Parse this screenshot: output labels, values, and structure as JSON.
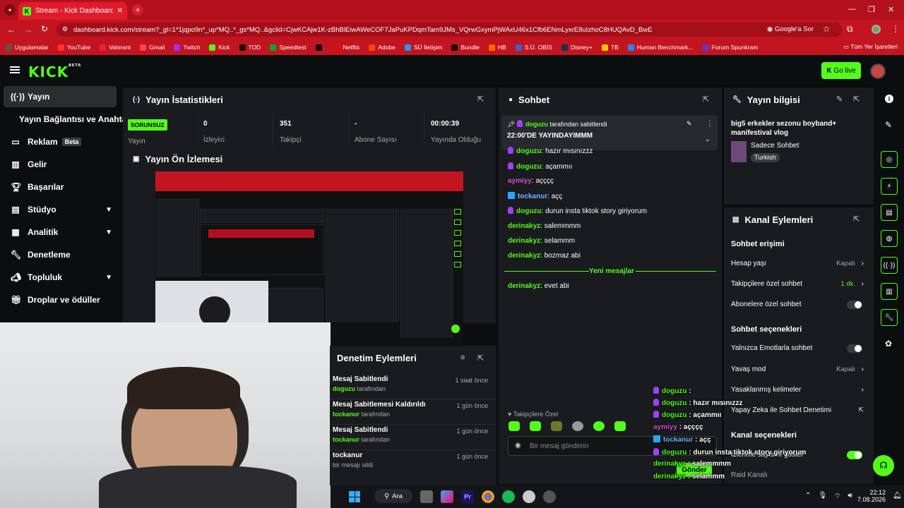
{
  "browser": {
    "tab_title": "Stream - Kick Dashboard",
    "url": "dashboard.kick.com/stream?_gl=1*1jqpo9n*_up*MQ..*_gs*MQ..&gclid=CjwKCAjw1K-zBhBlEiwAWeCOF7JaPuKPDqmTam9JMs_VQrwGxymPjWAxU46x1Cfb6ENmLyxrE8uIzhoC8HUQAvD_BwE",
    "ask_google": "Google'a Sor",
    "bookmarks": [
      "Uygulamalar",
      "YouTube",
      "Valorant",
      "Gmail",
      "Twitch",
      "Kick",
      "TOD",
      "Speedtest",
      "",
      "Netflix",
      "Adobe",
      "SÜ İletişim",
      "Bundle",
      "HB",
      "S.Ü. OBİS",
      "Disney+",
      "TB",
      "Human Benchmark...",
      "Forum Spunkram"
    ],
    "all_bookmarks": "Tüm Yer İşaretleri"
  },
  "header": {
    "logo": "KICK",
    "logo_sup": "BETA",
    "go_live": "Go live"
  },
  "sidebar": {
    "items": [
      {
        "label": "Yayın",
        "icon": "broadcast-icon"
      },
      {
        "label": "Yayın Bağlantısı ve Anahtarı"
      },
      {
        "label": "Reklam",
        "badge": "Beta",
        "icon": "tv-icon"
      },
      {
        "label": "Gelir",
        "icon": "chart-icon"
      },
      {
        "label": "Başarılar",
        "icon": "trophy-icon"
      },
      {
        "label": "Stüdyo",
        "icon": "studio-icon"
      },
      {
        "label": "Analitik",
        "icon": "analytics-icon"
      },
      {
        "label": "Denetleme",
        "icon": "wrench-icon"
      },
      {
        "label": "Topluluk",
        "icon": "megaphone-icon"
      },
      {
        "label": "Droplar ve ödüller",
        "icon": "gift-icon"
      }
    ]
  },
  "stats": {
    "title": "Yayın İstatistikleri",
    "status": "SORUNSUZ",
    "status_label": "Yayın",
    "viewers": "0",
    "viewers_label": "İzleyici",
    "followers": "351",
    "followers_label": "Takipçi",
    "subs": "-",
    "subs_label": "Abone Sayısı",
    "uptime": "00:00:39",
    "uptime_label": "Yayında Olduğu"
  },
  "preview": {
    "title": "Yayın Ön İzlemesi"
  },
  "moderation": {
    "title": "Denetim Eylemleri",
    "rows": [
      {
        "action": "Mesaj Sabitlendi",
        "user": "doguzu",
        "suffix": "tarafından",
        "time": "1 saat önce"
      },
      {
        "action": "Mesaj Sabitlemesi Kaldırıldı",
        "user": "tockanur",
        "suffix": "tarafından",
        "time": "1 gün önce"
      },
      {
        "action": "Mesaj Sabitlendi",
        "user": "tockanur",
        "suffix": "tarafından",
        "time": "1 gün önce"
      },
      {
        "action": "tockanur",
        "user": "",
        "suffix": "bir mesajı sildi",
        "time": "1 gün önce"
      }
    ]
  },
  "chat": {
    "title": "Sohbet",
    "pinned_by": "doguzu",
    "pinned_suffix": "tarafından sabitlendi",
    "pinned_text": "22:00'DE YAYINDAYIMMM",
    "messages": [
      {
        "user": "doguzu",
        "text": ": hazır mısınızzz",
        "color": "g",
        "badge": "p"
      },
      {
        "user": "doguzu",
        "text": ": açammıı",
        "color": "g",
        "badge": "p"
      },
      {
        "user": "aymiyy",
        "text": ": açççç",
        "color": "pk",
        "badge": ""
      },
      {
        "user": "tockanur",
        "text": ": açç",
        "color": "bl",
        "badge": "b"
      },
      {
        "user": "doguzu",
        "text": ": durun insta tiktok story giriyorum",
        "color": "g",
        "badge": "p"
      },
      {
        "user": "derinakyz",
        "text": ": salemmmm",
        "color": "g",
        "badge": ""
      },
      {
        "user": "derinakyz",
        "text": ": selammm",
        "color": "g",
        "badge": ""
      },
      {
        "user": "derinakyz",
        "text": ": bozmaz abi",
        "color": "g",
        "badge": ""
      }
    ],
    "new_messages": "Yeni mesajlar",
    "after": {
      "user": "derinakyz",
      "text": ": evet abi"
    },
    "followers_only": "Takipçilere Özel",
    "input_placeholder": "Bir mesaj gönderin",
    "send": "Gönder"
  },
  "stream_info": {
    "title": "Yayın bilgisi",
    "stream_title": "big5 erkekler sezonu boyband+ manifestival vlog",
    "category": "Sadece Sohbet",
    "language": "Turkish"
  },
  "channel_actions": {
    "title": "Kanal Eylemleri",
    "chat_access": "Sohbet erişimi",
    "account_age": "Hesap yaşı",
    "account_age_val": "Kapalı",
    "followers_only": "Takipçilere özel sohbet",
    "followers_only_val": "1 dk.",
    "subs_only": "Abonelere özel sohbet",
    "chat_options": "Sohbet seçenekleri",
    "emote_only": "Yalnızca Emotlarla sohbet",
    "slow_mode": "Yavaş mod",
    "slow_mode_val": "Kapalı",
    "banned_words": "Yasaklanmış kelimeler",
    "ai_moderation": "Yapay Zeka ile Sohbet Denetimi",
    "channel_options": "Kanal seçenekleri",
    "show_viewers": "İzlenme sayısını göster",
    "raid_channel": "Raid Kanalı"
  },
  "overlay": {
    "lines": [
      {
        "user": "doguzu",
        "text": " :"
      },
      {
        "user": "doguzu",
        "text": " : hazır mısınızzz"
      },
      {
        "user": "doguzu",
        "text": " : açammıı"
      },
      {
        "user": "aymiyy",
        "text": " : açççç"
      },
      {
        "user": "tockanur",
        "text": " : açç"
      },
      {
        "user": "doguzu",
        "text": " : durun insta tiktok story giriyorum"
      },
      {
        "user": "derinakyz",
        "text": " : salemmmm"
      },
      {
        "user": "derinakyz",
        "text": " : selammm"
      },
      {
        "user": "derinakyz",
        "text": " : bozmaz abi"
      },
      {
        "user": "derinakyz",
        "text": " : evet abi"
      }
    ]
  },
  "taskbar": {
    "search": "Ara",
    "time": "22:12",
    "date": "7.08.2026"
  },
  "colors": {
    "kick_green": "#53fc18",
    "browser_red": "#c2151f",
    "panel": "#191b1f"
  }
}
